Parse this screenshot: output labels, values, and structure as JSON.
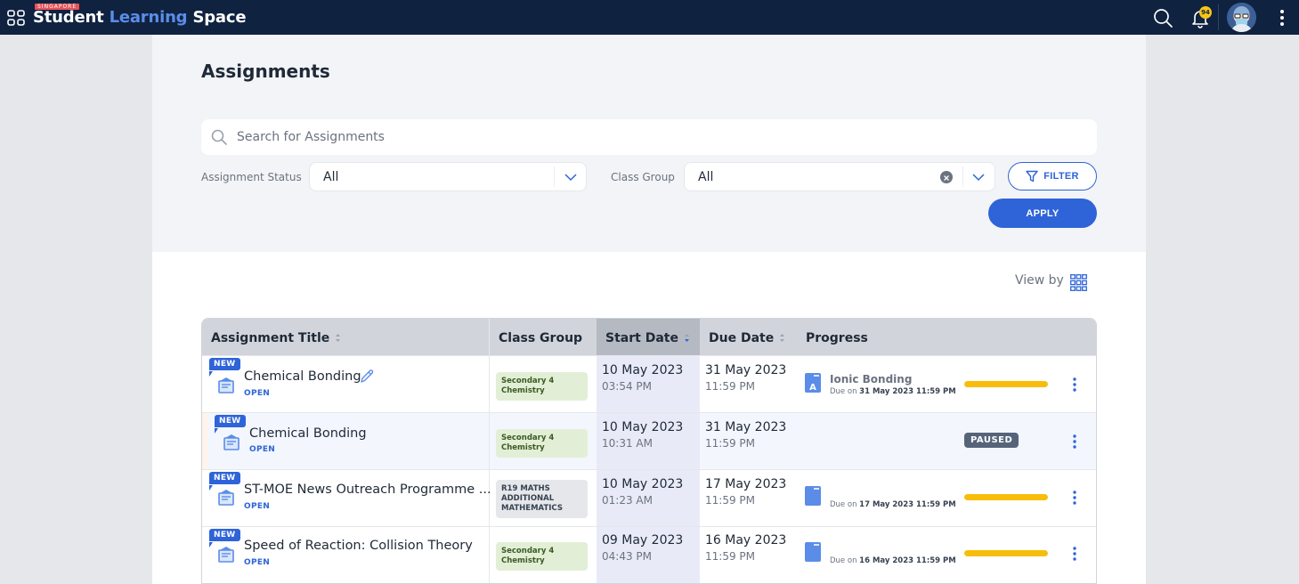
{
  "topbar": {
    "brand_tag": "SINGAPORE",
    "brand_part1": "Student",
    "brand_part2": "Learning",
    "brand_part3": "Space",
    "notification_count": "94",
    "icons": [
      "apps-grid-icon",
      "search-icon",
      "bell-icon",
      "avatar",
      "kebab-menu-icon"
    ]
  },
  "page": {
    "title": "Assignments"
  },
  "filters": {
    "search_placeholder": "Search for Assignments",
    "search_value": "",
    "status_label": "Assignment Status",
    "status_value": "All",
    "class_group_label": "Class Group",
    "class_group_value": "All",
    "filter_button": "FILTER",
    "apply_button": "APPLY"
  },
  "view": {
    "view_by_label": "View by"
  },
  "table": {
    "headers": {
      "title": "Assignment Title",
      "class_group": "Class Group",
      "start_date": "Start Date",
      "due_date": "Due Date",
      "progress": "Progress"
    },
    "sorted_column": "start_date",
    "rows": [
      {
        "badge": "NEW",
        "title": "Chemical Bonding",
        "status": "OPEN",
        "editable": true,
        "class_group": "Secondary 4 Chemistry",
        "class_group_style": "green",
        "start_date": "10 May 2023",
        "start_time": "03:54 PM",
        "due_date": "31 May 2023",
        "due_time": "11:59 PM",
        "progress_item_title": "Ionic Bonding",
        "progress_icon_letter": "A",
        "progress_due_prefix": "Due on",
        "progress_due": "31 May 2023 11:59 PM",
        "progress_fraction": 1.0,
        "state": ""
      },
      {
        "badge": "NEW",
        "title": "Chemical Bonding",
        "status": "OPEN",
        "editable": false,
        "class_group": "Secondary 4 Chemistry",
        "class_group_style": "green",
        "start_date": "10 May 2023",
        "start_time": "10:31 AM",
        "due_date": "31 May 2023",
        "due_time": "11:59 PM",
        "state": "PAUSED"
      },
      {
        "badge": "NEW",
        "title": "ST-MOE News Outreach Programme ...",
        "status": "OPEN",
        "editable": false,
        "class_group": "R19 MATHS ADDITIONAL MATHEMATICS",
        "class_group_style": "gray",
        "start_date": "10 May 2023",
        "start_time": "01:23 AM",
        "due_date": "17 May 2023",
        "due_time": "11:59 PM",
        "progress_item_title": "",
        "progress_due_prefix": "Due on",
        "progress_due": "17 May 2023 11:59 PM",
        "progress_fraction": 1.0,
        "state": ""
      },
      {
        "badge": "NEW",
        "title": "Speed of Reaction: Collision Theory",
        "status": "OPEN",
        "editable": false,
        "class_group": "Secondary 4 Chemistry",
        "class_group_style": "green",
        "start_date": "09 May 2023",
        "start_time": "04:43 PM",
        "due_date": "16 May 2023",
        "due_time": "11:59 PM",
        "progress_item_title": "",
        "progress_due_prefix": "Due on",
        "progress_due": "16 May 2023 11:59 PM",
        "progress_fraction": 1.0,
        "state": ""
      }
    ]
  },
  "colors": {
    "topbar": "#0f2240",
    "accent": "#2e64d8",
    "progress": "#f8bd0a",
    "paused": "#566479",
    "chip_green": "#e2efd6"
  }
}
